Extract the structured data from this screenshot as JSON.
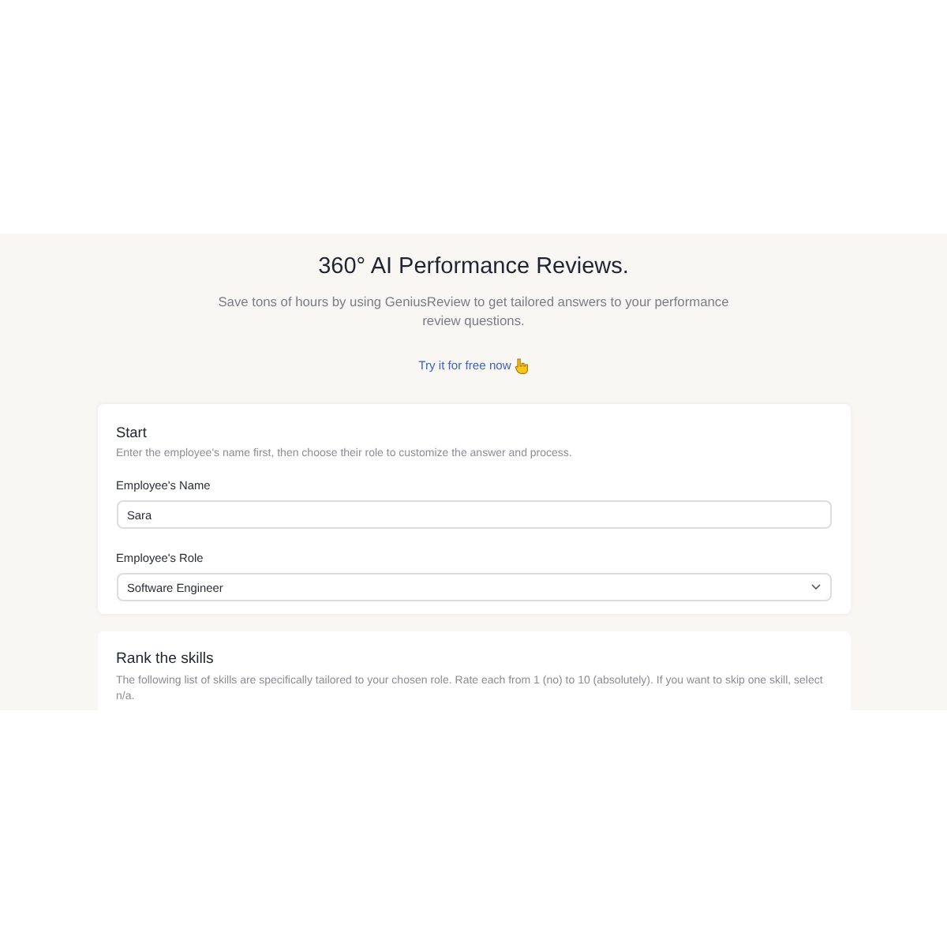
{
  "hero": {
    "title": "360° AI Performance Reviews.",
    "subtitle": "Save tons of hours by using GeniusReview to get tailored answers to your performance review questions.",
    "cta": "Try it for free now"
  },
  "start": {
    "title": "Start",
    "description": "Enter the employee's name first, then choose their role to customize the answer and process.",
    "name_label": "Employee's Name",
    "name_value": "Sara",
    "role_label": "Employee's Role",
    "role_value": "Software Engineer"
  },
  "skills": {
    "title": "Rank the skills",
    "description": "The following list of skills are specifically tailored to your chosen role. Rate each from 1 (no) to 10 (absolutely). If you want to skip one skill, select n/a."
  }
}
